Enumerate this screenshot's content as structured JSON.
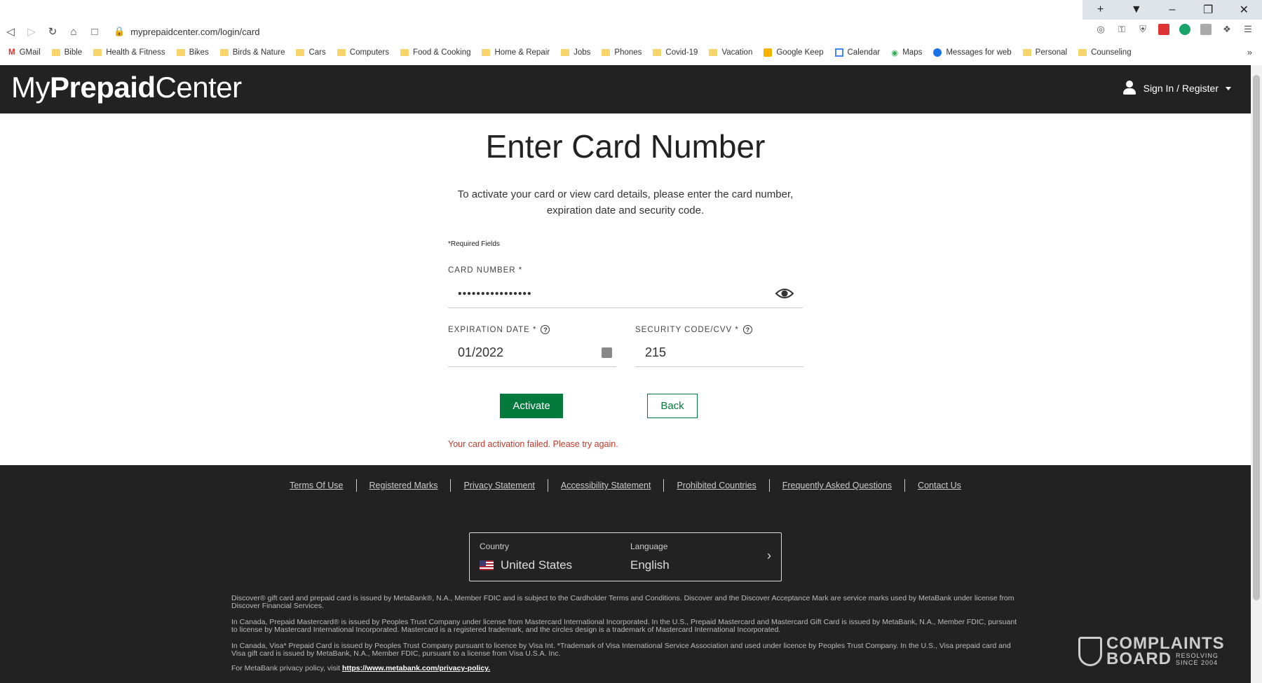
{
  "browser": {
    "url": "myprepaidcenter.com/login/card",
    "bookmarks": [
      "GMail",
      "Bible",
      "Health & Fitness",
      "Bikes",
      "Birds & Nature",
      "Cars",
      "Computers",
      "Food & Cooking",
      "Home & Repair",
      "Jobs",
      "Phones",
      "Covid-19",
      "Vacation",
      "Google Keep",
      "Calendar",
      "Maps",
      "Messages for web",
      "Personal",
      "Counseling"
    ],
    "bookmark_more": "»"
  },
  "header": {
    "logo_light_1": "My",
    "logo_bold": "Prepaid",
    "logo_light_2": "Center",
    "signin_label": "Sign In / Register"
  },
  "main": {
    "title": "Enter Card Number",
    "description": "To activate your card or view card details, please enter the card number, expiration date and security code.",
    "required_note": "*Required Fields",
    "card_number_label": "CARD NUMBER *",
    "card_number_value": "••••••••••••••••",
    "expiration_label": "EXPIRATION DATE *",
    "expiration_value": "01/2022",
    "security_label": "SECURITY CODE/CVV *",
    "security_value": "215",
    "activate_label": "Activate",
    "back_label": "Back",
    "error_message": "Your card activation failed. Please try again."
  },
  "footer": {
    "links": [
      "Terms Of Use",
      "Registered Marks",
      "Privacy Statement",
      "Accessibility Statement",
      "Prohibited Countries",
      "Frequently Asked Questions",
      "Contact Us"
    ],
    "country_label": "Country",
    "country_value": "United States",
    "language_label": "Language",
    "language_value": "English",
    "legal_1": "Discover® gift card and prepaid card is issued by MetaBank®, N.A., Member FDIC and is subject to the Cardholder Terms and Conditions. Discover and the Discover Acceptance Mark are service marks used by MetaBank under license from Discover Financial Services.",
    "legal_2": "In Canada, Prepaid Mastercard® is issued by Peoples Trust Company under license from Mastercard International Incorporated. In the U.S., Prepaid Mastercard and Mastercard Gift Card is issued by MetaBank, N.A., Member FDIC, pursuant to license by Mastercard International Incorporated. Mastercard is a registered trademark, and the circles design is a trademark of Mastercard International Incorporated.",
    "legal_3": "In Canada, Visa* Prepaid Card is issued by Peoples Trust Company pursuant to licence by Visa Int. *Trademark of Visa International Service Association and used under licence by Peoples Trust Company. In the U.S., Visa prepaid card and Visa gift card is issued by MetaBank, N.A., Member FDIC, pursuant to a license from Visa U.S.A. Inc.",
    "privacy_prefix": "For MetaBank privacy policy, visit ",
    "privacy_link": "https://www.metabank.com/privacy-policy.",
    "watermark_line1": "COMPLAINTS",
    "watermark_line2": "BOARD",
    "watermark_sub1": "RESOLVING",
    "watermark_sub2": "SINCE 2004"
  },
  "colors": {
    "brand_green": "#047a3d",
    "header_bg": "#222222",
    "error": "#c0392b"
  }
}
